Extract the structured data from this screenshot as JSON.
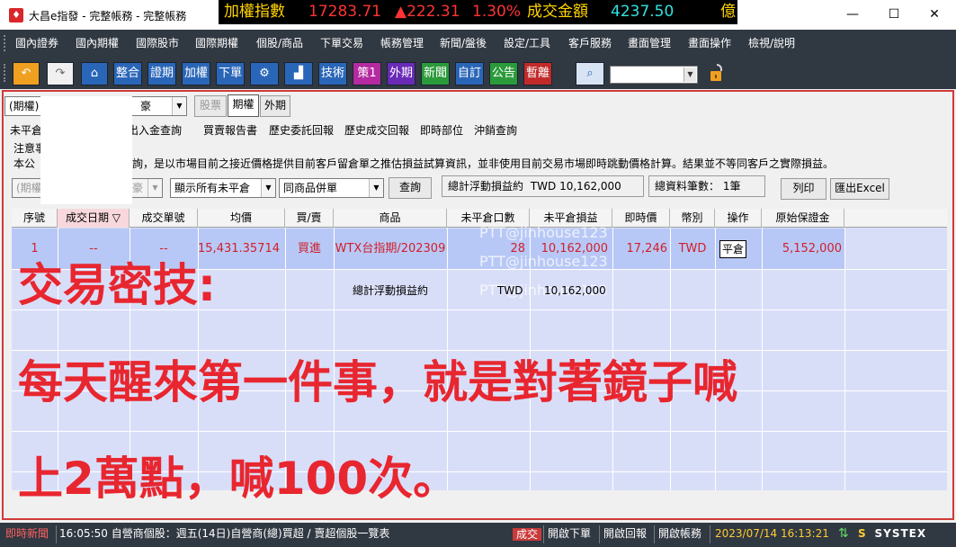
{
  "window": {
    "title": "大昌e指發 - 完整帳務 - 完整帳務",
    "minimize_glyph": "—",
    "maximize_glyph": "☐",
    "close_glyph": "✕"
  },
  "ticker": {
    "label": "加權指數",
    "index": "17283.71",
    "change": "▲222.31",
    "pct": "1.30%",
    "volume_label": "成交金額",
    "volume": "4237.50",
    "unit": "億",
    "colors": {
      "label": "#ffd400",
      "value": "#ff3333",
      "volume": "#33e0e0"
    }
  },
  "menu": [
    "國內證券",
    "國內期權",
    "國際股市",
    "國際期權",
    "個股/商品",
    "下單交易",
    "帳務管理",
    "新聞/盤後",
    "設定/工具",
    "客戶服務",
    "畫面管理",
    "畫面操作",
    "檢視/說明"
  ],
  "toolbar": {
    "buttons": [
      {
        "label": "整合",
        "color": "#2a66b8"
      },
      {
        "label": "證期",
        "color": "#2a66b8"
      },
      {
        "label": "加權",
        "color": "#2a66b8"
      },
      {
        "label": "下單",
        "color": "#2a66b8"
      },
      {
        "label": "技術",
        "color": "#2a66b8"
      },
      {
        "label": "策1",
        "color": "#b52aa0"
      },
      {
        "label": "外期",
        "color": "#6a2ab8"
      },
      {
        "label": "新聞",
        "color": "#2a9a3a"
      },
      {
        "label": "自訂",
        "color": "#2a66b8"
      },
      {
        "label": "公告",
        "color": "#2a9a3a"
      },
      {
        "label": "暫離",
        "color": "#c22a2a"
      }
    ]
  },
  "panel": {
    "market_select": "(期權)",
    "market_select_tail": "豪",
    "market_tabs": [
      "股票",
      "期權",
      "外期"
    ],
    "subtabs": [
      "未平倉",
      "出入金查詢",
      "買賣報告書",
      "歷史委託回報",
      "歷史成交回報",
      "即時部位",
      "沖銷查詢"
    ],
    "note_line1": "注意事",
    "note_line2_head": "本公",
    "note_line2": "詢，是以市場目前之接近價格提供目前客戶留倉單之推估損益試算資訊，並非使用目前交易市場即時跳動價格計算。結果並不等同客戶之實際損益。",
    "filter_account": "(期權",
    "filter_account_tail": "豪",
    "filter_show": "顯示所有未平倉",
    "filter_merge": "同商品併單",
    "query_button": "查詢",
    "total_float_label": "總計浮動損益約",
    "total_float_value": "TWD 10,162,000",
    "total_count_label": "總資料筆數：",
    "total_count_value": "1筆",
    "print_button": "列印",
    "excel_button": "匯出Excel"
  },
  "table": {
    "headers": [
      "序號",
      "成交日期 ▽",
      "成交單號",
      "均價",
      "買/賣",
      "商品",
      "未平倉口數",
      "未平倉損益",
      "即時價",
      "幣別",
      "操作",
      "原始保證金"
    ],
    "row": {
      "seq": "1",
      "date": "--",
      "order_no": "--",
      "avg_price": "15,431.35714",
      "side": "買進",
      "product": "WTX台指期/202309",
      "lots": "28",
      "pnl": "10,162,000",
      "price": "17,246",
      "currency": "TWD",
      "action": "平倉",
      "margin": "5,152,000"
    },
    "summary": {
      "label": "總計浮動損益約",
      "currency": "TWD",
      "value": "10,162,000"
    },
    "watermark": "PTT@jinhouse123"
  },
  "overlay": {
    "line1": "交易密技:",
    "line2": "每天醒來第一件事，就是對著鏡子喊",
    "line3": "上2萬點，喊100次。"
  },
  "status": {
    "news_label": "即時新聞",
    "news_text": "16:05:50 自營商個股：週五(14日)自營商(總)買超 / 賣超個股一覽表",
    "deal_tag": "成交",
    "open_order": "開啟下單",
    "open_report": "開啟回報",
    "open_account": "開啟帳務",
    "datetime": "2023/07/14 16:13:21",
    "vendor": "SYSTEX"
  }
}
